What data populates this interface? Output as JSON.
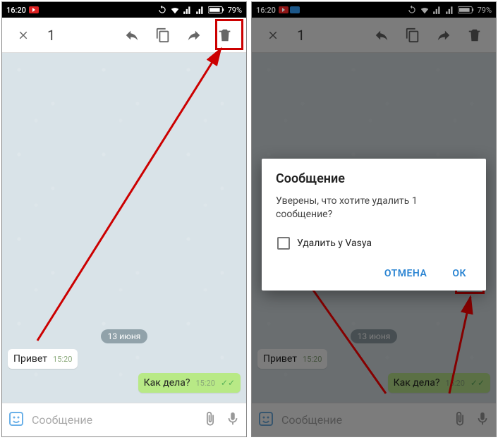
{
  "statusbar": {
    "time": "16:20",
    "battery": "79%"
  },
  "toolbar": {
    "count": "1"
  },
  "chat": {
    "date": "13 июня",
    "msg_in": {
      "text": "Привет",
      "ts": "15:20"
    },
    "msg_out": {
      "text": "Как дела?",
      "ts": "15:20"
    }
  },
  "inputbar": {
    "placeholder": "Сообщение"
  },
  "dialog": {
    "title": "Сообщение",
    "body": "Уверены, что хотите удалить 1 сообщение?",
    "checkbox_label": "Удалить у Vasya",
    "cancel": "ОТМЕНА",
    "ok": "ОК"
  }
}
